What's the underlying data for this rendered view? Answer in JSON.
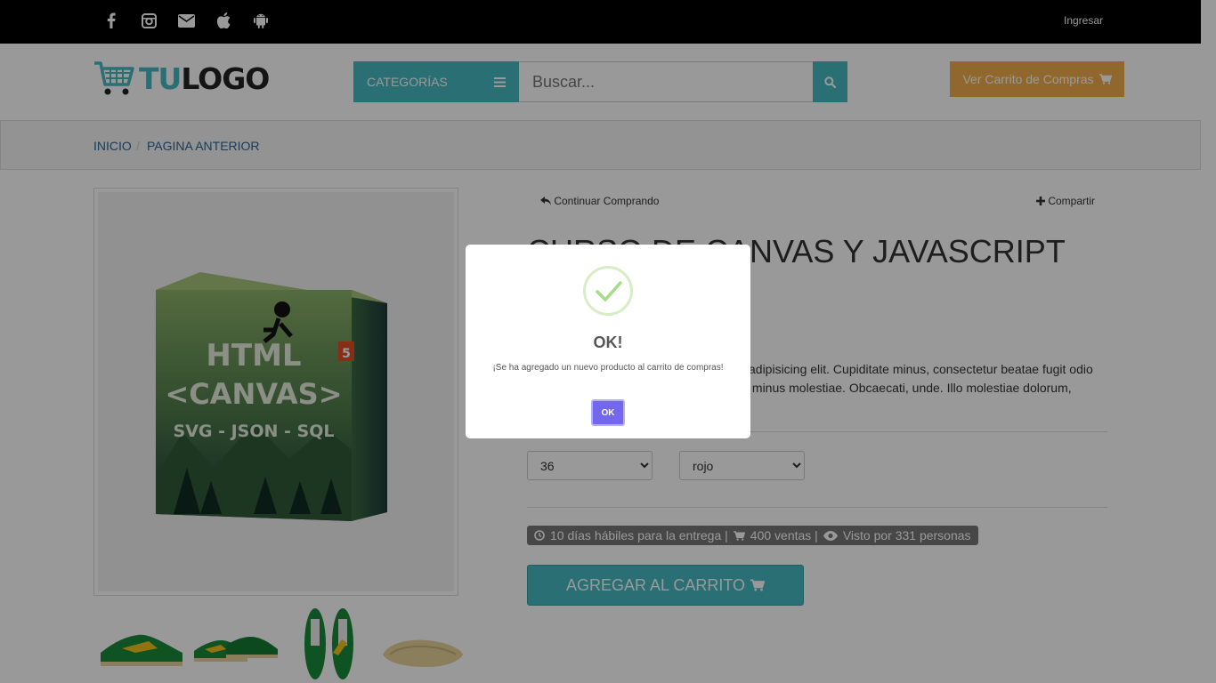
{
  "topbar": {
    "social_icons": [
      "facebook-icon",
      "instagram-icon",
      "envelope-icon",
      "apple-icon",
      "android-icon"
    ],
    "login_label": "Ingresar"
  },
  "header": {
    "logo_part1": "TU",
    "logo_part2": "LOGO",
    "categories_label": "CATEGORÍAS",
    "search_placeholder": "Buscar...",
    "cart_label": "Ver Carrito de Compras"
  },
  "breadcrumb": {
    "items": [
      "INICIO",
      "PAGINA ANTERIOR"
    ],
    "separator": "/"
  },
  "product": {
    "continue_label": "Continuar Comprando",
    "share_label": "Compartir",
    "title": "CURSO DE CANVAS Y JAVASCRIPT",
    "description": "Lorem ipsum dolor sit amet consectetur adipisicing elit. Cupiditate minus, consectetur beatae fugit odio quibusdam numquam nostrum, delectus minus molestiae. Obcaecati, unde. Illo molestiae dolorum, saepe",
    "image_text": {
      "line1": "HTML",
      "line2": "<CANVAS>",
      "line3": "SVG - JSON - SQL",
      "badge": "5"
    },
    "size_value": "36",
    "color_value": "rojo",
    "delivery": "10 días hábiles para la entrega |",
    "sales": "400 ventas |",
    "views": "Visto por 331 personas",
    "add_to_cart": "AGREGAR AL CARRITO"
  },
  "modal": {
    "title": "OK!",
    "text": "¡Se ha agregado un nuevo producto al carrito de compras!",
    "ok_label": "OK"
  },
  "colors": {
    "accent": "#47bac1",
    "cart_button": "#f0ad4e",
    "modal_button": "#7367f0",
    "check": "#a5dc86"
  }
}
